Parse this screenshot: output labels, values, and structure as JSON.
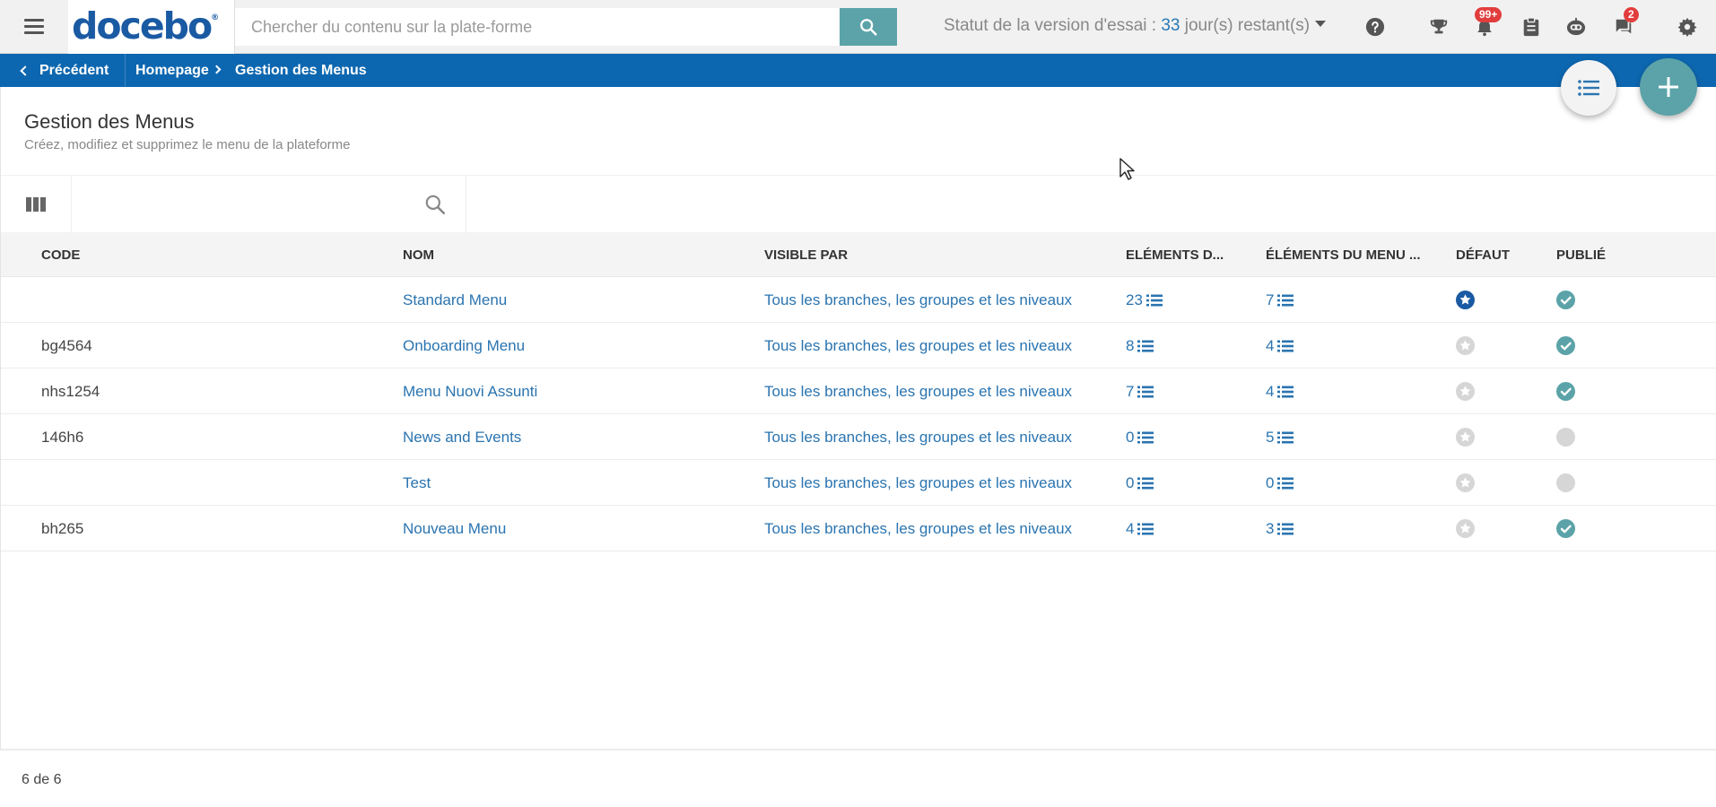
{
  "topbar": {
    "logo": "docebo",
    "logo_mark": "®",
    "search_placeholder": "Chercher du contenu sur la plate-forme",
    "trial_prefix": "Statut de la version d'essai : ",
    "trial_days": "33",
    "trial_suffix": " jour(s) restant(s)",
    "notifications_badge": "99+",
    "messages_badge": "2",
    "icons": [
      "menu-icon",
      "search-icon",
      "help-icon",
      "trophy-icon",
      "bell-icon",
      "clipboard-icon",
      "bot-icon",
      "chat-icon",
      "gear-icon"
    ]
  },
  "breadcrumb": {
    "back": "Précédent",
    "home": "Homepage",
    "current": "Gestion des Menus"
  },
  "page": {
    "title": "Gestion des Menus",
    "subtitle": "Créez, modifiez et supprimez le menu de la plateforme"
  },
  "table": {
    "headers": {
      "code": "CODE",
      "nom": "NOM",
      "visible": "VISIBLE PAR",
      "el1": "ELÉMENTS D...",
      "el2": "ÉLÉMENTS DU MENU ...",
      "defaut": "DÉFAUT",
      "publie": "PUBLIÉ"
    },
    "rows": [
      {
        "code": "",
        "nom": "Standard Menu",
        "visible": "Tous les branches, les groupes et les niveaux",
        "el1": "23",
        "el2": "7",
        "defaut": true,
        "publie": true
      },
      {
        "code": "bg4564",
        "nom": "Onboarding Menu",
        "visible": "Tous les branches, les groupes et les niveaux",
        "el1": "8",
        "el2": "4",
        "defaut": false,
        "publie": true
      },
      {
        "code": "nhs1254",
        "nom": "Menu Nuovi Assunti",
        "visible": "Tous les branches, les groupes et les niveaux",
        "el1": "7",
        "el2": "4",
        "defaut": false,
        "publie": true
      },
      {
        "code": "146h6",
        "nom": "News and Events",
        "visible": "Tous les branches, les groupes et les niveaux",
        "el1": "0",
        "el2": "5",
        "defaut": false,
        "publie": false
      },
      {
        "code": "",
        "nom": "Test",
        "visible": "Tous les branches, les groupes et les niveaux",
        "el1": "0",
        "el2": "0",
        "defaut": false,
        "publie": false
      },
      {
        "code": "bh265",
        "nom": "Nouveau Menu",
        "visible": "Tous les branches, les groupes et les niveaux",
        "el1": "4",
        "el2": "3",
        "defaut": false,
        "publie": true
      }
    ]
  },
  "footer": {
    "count": "6 de 6"
  },
  "colors": {
    "brand_blue": "#0d67b0",
    "teal": "#5ba3a8",
    "link": "#2a74b0",
    "badge_red": "#e23d3d",
    "default_star": "#1a5aa3",
    "inactive": "#d6d6d6"
  }
}
